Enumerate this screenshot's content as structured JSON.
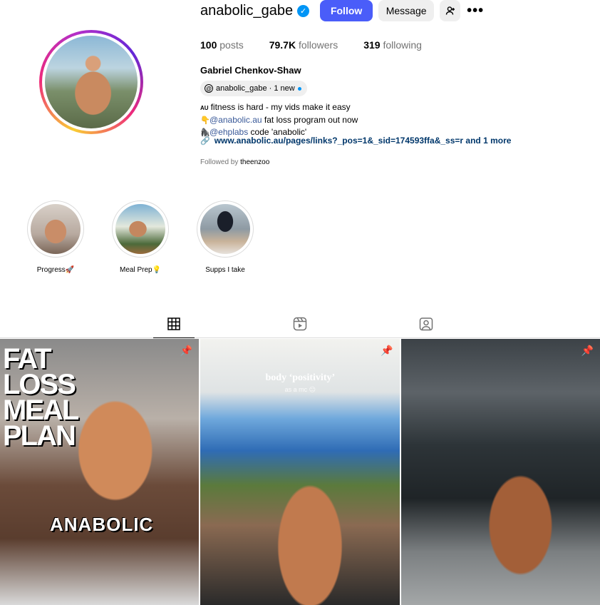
{
  "profile": {
    "username": "anabolic_gabe",
    "follow_label": "Follow",
    "message_label": "Message",
    "stats": {
      "posts_count": "100",
      "posts_label": "posts",
      "followers_count": "79.7K",
      "followers_label": "followers",
      "following_count": "319",
      "following_label": "following"
    },
    "full_name": "Gabriel Chenkov-Shaw",
    "threads_badge": "anabolic_gabe · 1 new",
    "bio": {
      "line1_flag": "AU",
      "line1_text": "fitness is hard - my vids make it easy",
      "line2_mention": "@anabolic.au",
      "line2_text": " fat loss program out now",
      "line3_mention": "@ehplabs",
      "line3_text": " code 'anabolic'"
    },
    "link": "www.anabolic.au/pages/links?_pos=1&_sid=174593ffa&_ss=r and 1 more",
    "followed_by_prefix": "Followed by ",
    "followed_by_user": "theenzoo"
  },
  "highlights": [
    {
      "label": "Progress🚀"
    },
    {
      "label": "Meal Prep💡"
    },
    {
      "label": "Supps I take"
    }
  ],
  "tabs": [
    "posts-grid-icon",
    "reels-icon",
    "tagged-icon"
  ],
  "posts": [
    {
      "title": "FAT LOSS MEAL PLAN",
      "brand": "ANABOLIC"
    },
    {
      "title": "body ‘positivity’",
      "subtitle": "as a mc 😑"
    },
    {}
  ],
  "colors": {
    "follow_button": "#4a5df9",
    "verified": "#0095f6",
    "mention": "#385898"
  }
}
